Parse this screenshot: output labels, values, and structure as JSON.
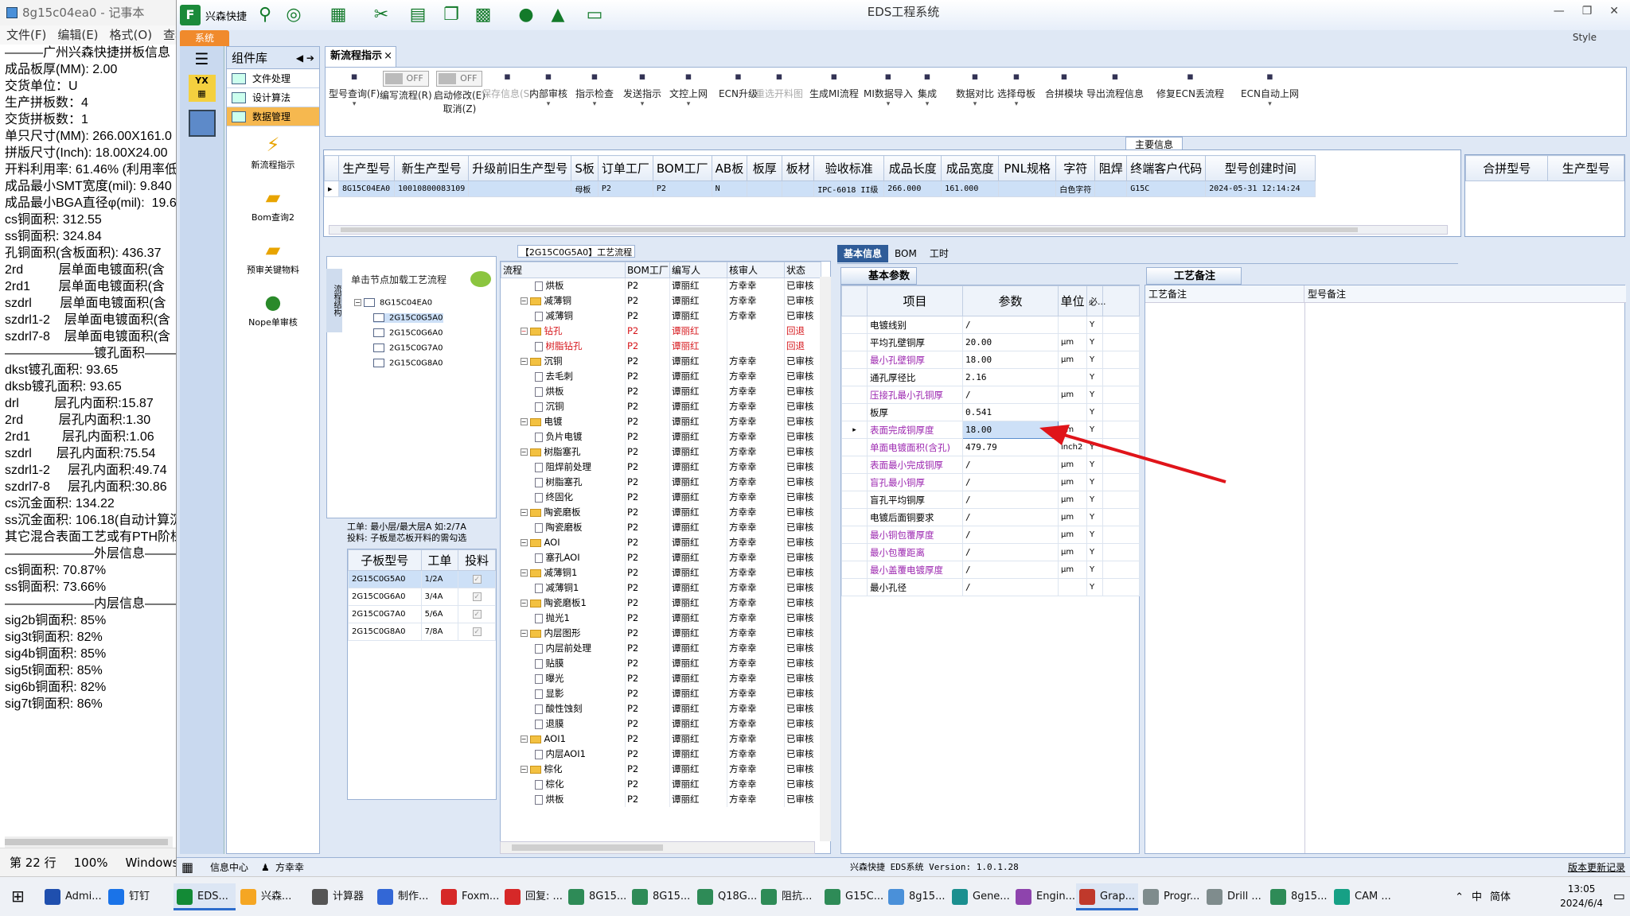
{
  "notepad": {
    "title": "8g15c04ea0 - 记事本",
    "menu": [
      "文件(F)",
      "编辑(E)",
      "格式(O)",
      "查看"
    ],
    "lines": [
      "———广州兴森快捷拼板信息",
      "成品板厚(MM): 2.00",
      "交货单位：U",
      "生产拼板数：4",
      "交货拼板数：1",
      "",
      "单只尺寸(MM): 266.00X161.0",
      "拼版尺寸(Inch): 18.00X24.00",
      "开料利用率: 61.46% (利用率低",
      "",
      "成品最小SMT宽度(mil): 9.840",
      "成品最小BGA直径φ(mil):  19.6",
      "",
      "cs铜面积: 312.55",
      "ss铜面积: 324.84",
      "孔铜面积(含板面积): 436.37",
      "2rd          层单面电镀面积(含",
      "2rd1        层单面电镀面积(含",
      "szdrl        层单面电镀面积(含",
      "szdrl1-2    层单面电镀面积(含",
      "szdrl7-8    层单面电镀面积(含",
      "",
      "———————镀孔面积————",
      "dkst镀孔面积: 93.65",
      "dksb镀孔面积: 93.65",
      "",
      "",
      "drl          层孔内面积:15.87",
      "2rd          层孔内面积:1.30",
      "2rd1         层孔内面积:1.06",
      "szdrl       层孔内面积:75.54",
      "szdrl1-2     层孔内面积:49.74",
      "szdrl7-8     层孔内面积:30.86",
      "",
      "",
      "cs沉金面积: 134.22",
      "ss沉金面积: 106.18(自动计算沉",
      "其它混合表面工艺或有PTH阶梯",
      "———————外层信息————",
      "cs铜面积: 70.87%",
      "ss铜面积: 73.66%",
      "———————内层信息————",
      "sig2b铜面积: 85%",
      "sig3t铜面积: 82%",
      "sig4b铜面积: 85%",
      "sig5t铜面积: 85%",
      "sig6b铜面积: 82%",
      "sig7t铜面积: 86%"
    ],
    "status": [
      "第 22 行",
      "100%",
      "Windows (CR"
    ]
  },
  "app": {
    "title": "EDS工程系统",
    "brand": "兴森快捷",
    "sys_tab": "系统",
    "style_label": "Style",
    "nav_header": "组件库",
    "nav_items": [
      "文件处理",
      "设计算法",
      "数据管理"
    ],
    "nav_big": [
      "新流程指示",
      "Bom查询2",
      "预审关键物料",
      "Nope单审核"
    ],
    "main_tab": "新流程指示",
    "ribbon": [
      {
        "label": "型号查询(F)",
        "icon": "search-icon"
      },
      {
        "label": "编写流程(R)",
        "toggle": "OFF"
      },
      {
        "label": "启动修改(E)",
        "sub": "取消(Z)",
        "toggle": "OFF"
      },
      {
        "label": "保存信息(S)",
        "disabled": true
      },
      {
        "label": "内部审核"
      },
      {
        "label": "指示检查"
      },
      {
        "label": "发送指示"
      },
      {
        "label": "文控上网"
      },
      {
        "label": "ECN升级"
      },
      {
        "label": "重选开料图",
        "disabled": true
      },
      {
        "label": "生成MI流程"
      },
      {
        "label": "MI数据导入"
      },
      {
        "label": "集成"
      },
      {
        "label": "数据对比"
      },
      {
        "label": "选择母板"
      },
      {
        "label": "合拼模块"
      },
      {
        "label": "导出流程信息"
      },
      {
        "label": "修复ECN丢流程"
      },
      {
        "label": "ECN自动上网"
      }
    ],
    "main_section_label": "主要信息",
    "main_grid": {
      "headers": [
        "生产型号",
        "新生产型号",
        "升级前旧生产型号",
        "S板",
        "订单工厂",
        "BOM工厂",
        "AB板",
        "板厚",
        "板材",
        "验收标准",
        "成品长度",
        "成品宽度",
        "PNL规格",
        "字符",
        "阻焊",
        "终端客户代码",
        "型号创建时间"
      ],
      "row": [
        "8G15C04EA0",
        "10010800083109",
        "",
        "母板",
        "P2",
        "P2",
        "N",
        "",
        "",
        "IPC-6018 II级",
        "266.000",
        "161.000",
        "",
        "白色字符",
        "",
        "G15C",
        "2024-05-31 12:14:24"
      ],
      "side_headers": [
        "合拼型号",
        "生产型号"
      ]
    },
    "flow_section_label": "【2G15C0G5A0】工艺流程",
    "tree_hint": "单击节点加载工艺流程",
    "tree": [
      "8G15C04EA0",
      "2G15C0G5A0",
      "2G15C0G6A0",
      "2G15C0G7A0",
      "2G15C0G8A0"
    ],
    "vtab": "流程结构",
    "work_info": [
      "工单: 最小层/最大层A 如:2/7A",
      "投料: 子板是芯板开料的需勾选"
    ],
    "child_grid": {
      "headers": [
        "子板型号",
        "工单",
        "投料"
      ],
      "rows": [
        [
          "2G15C0G5A0",
          "1/2A"
        ],
        [
          "2G15C0G6A0",
          "3/4A"
        ],
        [
          "2G15C0G7A0",
          "5/6A"
        ],
        [
          "2G15C0G8A0",
          "7/8A"
        ]
      ]
    },
    "flow_grid": {
      "headers": [
        "流程",
        "BOM工厂",
        "编写人",
        "核审人",
        "状态"
      ],
      "rows": [
        {
          "lvl": 1,
          "name": "烘板",
          "f": "P2",
          "w": "谭丽红",
          "r": "方幸幸",
          "s": "已审核"
        },
        {
          "lvl": 0,
          "name": "减薄铜",
          "f": "P2",
          "w": "谭丽红",
          "r": "方幸幸",
          "s": "已审核"
        },
        {
          "lvl": 1,
          "name": "减薄铜",
          "f": "P2",
          "w": "谭丽红",
          "r": "方幸幸",
          "s": "已审核"
        },
        {
          "lvl": 0,
          "name": "钻孔",
          "f": "P2",
          "w": "谭丽红",
          "r": "",
          "s": "回退",
          "red": true
        },
        {
          "lvl": 1,
          "name": "树脂钻孔",
          "f": "P2",
          "w": "谭丽红",
          "r": "",
          "s": "回退",
          "red": true
        },
        {
          "lvl": 0,
          "name": "沉铜",
          "f": "P2",
          "w": "谭丽红",
          "r": "方幸幸",
          "s": "已审核"
        },
        {
          "lvl": 1,
          "name": "去毛刺",
          "f": "P2",
          "w": "谭丽红",
          "r": "方幸幸",
          "s": "已审核"
        },
        {
          "lvl": 1,
          "name": "烘板",
          "f": "P2",
          "w": "谭丽红",
          "r": "方幸幸",
          "s": "已审核"
        },
        {
          "lvl": 1,
          "name": "沉铜",
          "f": "P2",
          "w": "谭丽红",
          "r": "方幸幸",
          "s": "已审核"
        },
        {
          "lvl": 0,
          "name": "电镀",
          "f": "P2",
          "w": "谭丽红",
          "r": "方幸幸",
          "s": "已审核"
        },
        {
          "lvl": 1,
          "name": "负片电镀",
          "f": "P2",
          "w": "谭丽红",
          "r": "方幸幸",
          "s": "已审核"
        },
        {
          "lvl": 0,
          "name": "树脂塞孔",
          "f": "P2",
          "w": "谭丽红",
          "r": "方幸幸",
          "s": "已审核"
        },
        {
          "lvl": 1,
          "name": "阻焊前处理",
          "f": "P2",
          "w": "谭丽红",
          "r": "方幸幸",
          "s": "已审核"
        },
        {
          "lvl": 1,
          "name": "树脂塞孔",
          "f": "P2",
          "w": "谭丽红",
          "r": "方幸幸",
          "s": "已审核"
        },
        {
          "lvl": 1,
          "name": "终固化",
          "f": "P2",
          "w": "谭丽红",
          "r": "方幸幸",
          "s": "已审核"
        },
        {
          "lvl": 0,
          "name": "陶瓷磨板",
          "f": "P2",
          "w": "谭丽红",
          "r": "方幸幸",
          "s": "已审核"
        },
        {
          "lvl": 1,
          "name": "陶瓷磨板",
          "f": "P2",
          "w": "谭丽红",
          "r": "方幸幸",
          "s": "已审核"
        },
        {
          "lvl": 0,
          "name": "AOI",
          "f": "P2",
          "w": "谭丽红",
          "r": "方幸幸",
          "s": "已审核"
        },
        {
          "lvl": 1,
          "name": "塞孔AOI",
          "f": "P2",
          "w": "谭丽红",
          "r": "方幸幸",
          "s": "已审核"
        },
        {
          "lvl": 0,
          "name": "减薄铜1",
          "f": "P2",
          "w": "谭丽红",
          "r": "方幸幸",
          "s": "已审核"
        },
        {
          "lvl": 1,
          "name": "减薄铜1",
          "f": "P2",
          "w": "谭丽红",
          "r": "方幸幸",
          "s": "已审核"
        },
        {
          "lvl": 0,
          "name": "陶瓷磨板1",
          "f": "P2",
          "w": "谭丽红",
          "r": "方幸幸",
          "s": "已审核"
        },
        {
          "lvl": 1,
          "name": "抛光1",
          "f": "P2",
          "w": "谭丽红",
          "r": "方幸幸",
          "s": "已审核"
        },
        {
          "lvl": 0,
          "name": "内层图形",
          "f": "P2",
          "w": "谭丽红",
          "r": "方幸幸",
          "s": "已审核"
        },
        {
          "lvl": 1,
          "name": "内层前处理",
          "f": "P2",
          "w": "谭丽红",
          "r": "方幸幸",
          "s": "已审核"
        },
        {
          "lvl": 1,
          "name": "贴膜",
          "f": "P2",
          "w": "谭丽红",
          "r": "方幸幸",
          "s": "已审核"
        },
        {
          "lvl": 1,
          "name": "曝光",
          "f": "P2",
          "w": "谭丽红",
          "r": "方幸幸",
          "s": "已审核"
        },
        {
          "lvl": 1,
          "name": "显影",
          "f": "P2",
          "w": "谭丽红",
          "r": "方幸幸",
          "s": "已审核"
        },
        {
          "lvl": 1,
          "name": "酸性蚀刻",
          "f": "P2",
          "w": "谭丽红",
          "r": "方幸幸",
          "s": "已审核"
        },
        {
          "lvl": 1,
          "name": "退膜",
          "f": "P2",
          "w": "谭丽红",
          "r": "方幸幸",
          "s": "已审核"
        },
        {
          "lvl": 0,
          "name": "AOI1",
          "f": "P2",
          "w": "谭丽红",
          "r": "方幸幸",
          "s": "已审核"
        },
        {
          "lvl": 1,
          "name": "内层AOI1",
          "f": "P2",
          "w": "谭丽红",
          "r": "方幸幸",
          "s": "已审核"
        },
        {
          "lvl": 0,
          "name": "棕化",
          "f": "P2",
          "w": "谭丽红",
          "r": "方幸幸",
          "s": "已审核"
        },
        {
          "lvl": 1,
          "name": "棕化",
          "f": "P2",
          "w": "谭丽红",
          "r": "方幸幸",
          "s": "已审核"
        },
        {
          "lvl": 1,
          "name": "烘板",
          "f": "P2",
          "w": "谭丽红",
          "r": "方幸幸",
          "s": "已审核"
        }
      ]
    },
    "right_tabs": [
      "基本信息",
      "BOM",
      "工时"
    ],
    "basic_header": "基本参数",
    "basic_grid": {
      "headers": [
        "项目",
        "参数",
        "单位",
        "必..."
      ],
      "rows": [
        {
          "item": "电镀线别",
          "val": "/",
          "unit": "",
          "req": "Y"
        },
        {
          "item": "平均孔壁铜厚",
          "val": "20.00",
          "unit": "μm",
          "req": "Y"
        },
        {
          "item": "最小孔壁铜厚",
          "val": "18.00",
          "unit": "μm",
          "req": "Y",
          "pur": true
        },
        {
          "item": "通孔厚径比",
          "val": "2.16",
          "unit": "",
          "req": "Y"
        },
        {
          "item": "压接孔最小孔铜厚",
          "val": "/",
          "unit": "μm",
          "req": "Y",
          "pur": true
        },
        {
          "item": "板厚",
          "val": "0.541",
          "unit": "",
          "req": "Y"
        },
        {
          "item": "表面完成铜厚度",
          "val": "18.00",
          "unit": "μm",
          "req": "Y",
          "pur": true,
          "sel": true
        },
        {
          "item": "单面电镀面积(含孔)",
          "val": "479.79",
          "unit": "inch2",
          "req": "Y",
          "pur": true
        },
        {
          "item": "表面最小完成铜厚",
          "val": "/",
          "unit": "μm",
          "req": "Y",
          "pur": true
        },
        {
          "item": "盲孔最小铜厚",
          "val": "/",
          "unit": "μm",
          "req": "Y",
          "pur": true
        },
        {
          "item": "盲孔平均铜厚",
          "val": "/",
          "unit": "μm",
          "req": "Y"
        },
        {
          "item": "电镀后面铜要求",
          "val": "/",
          "unit": "μm",
          "req": "Y"
        },
        {
          "item": "最小铜包覆厚度",
          "val": "/",
          "unit": "μm",
          "req": "Y",
          "pur": true
        },
        {
          "item": "最小包覆距离",
          "val": "/",
          "unit": "μm",
          "req": "Y",
          "pur": true
        },
        {
          "item": "最小盖覆电镀厚度",
          "val": "/",
          "unit": "μm",
          "req": "Y",
          "pur": true
        },
        {
          "item": "最小孔径",
          "val": "/",
          "unit": "",
          "req": "Y"
        }
      ]
    },
    "remark_header": "工艺备注",
    "remark_cols": [
      "工艺备注",
      "型号备注"
    ],
    "status": {
      "info_center": "信息中心",
      "user": "方幸幸",
      "version": "兴森快捷  EDS系统 Version: 1.0.1.28",
      "update": "版本更新记录"
    }
  },
  "taskbar": {
    "items": [
      "Admi...",
      "钉钉",
      "EDS...",
      "兴森...",
      "计算器",
      "制作...",
      "Foxm...",
      "回复: ...",
      "8G15...",
      "8G15...",
      "Q18G...",
      "阻抗...",
      "G15C...",
      "8g15...",
      "Gene...",
      "Engin...",
      "Grap...",
      "Progr...",
      "Drill ...",
      "8g15...",
      "CAM ..."
    ],
    "ime": [
      "中",
      "简体"
    ],
    "time": "13:05",
    "date": "2024/6/4",
    "colors": [
      "#1f4fae",
      "#1a73e8",
      "#138a36",
      "#f5a623",
      "#555555",
      "#3367d6",
      "#d62828",
      "#d62828",
      "#2e8b57",
      "#2e8b57",
      "#2e8b57",
      "#2e8b57",
      "#2e8b57",
      "#4a90d9",
      "#1b8f8f",
      "#8e44ad",
      "#c0392b",
      "#7f8c8d",
      "#7f8c8d",
      "#2e8b57",
      "#16a085"
    ]
  }
}
